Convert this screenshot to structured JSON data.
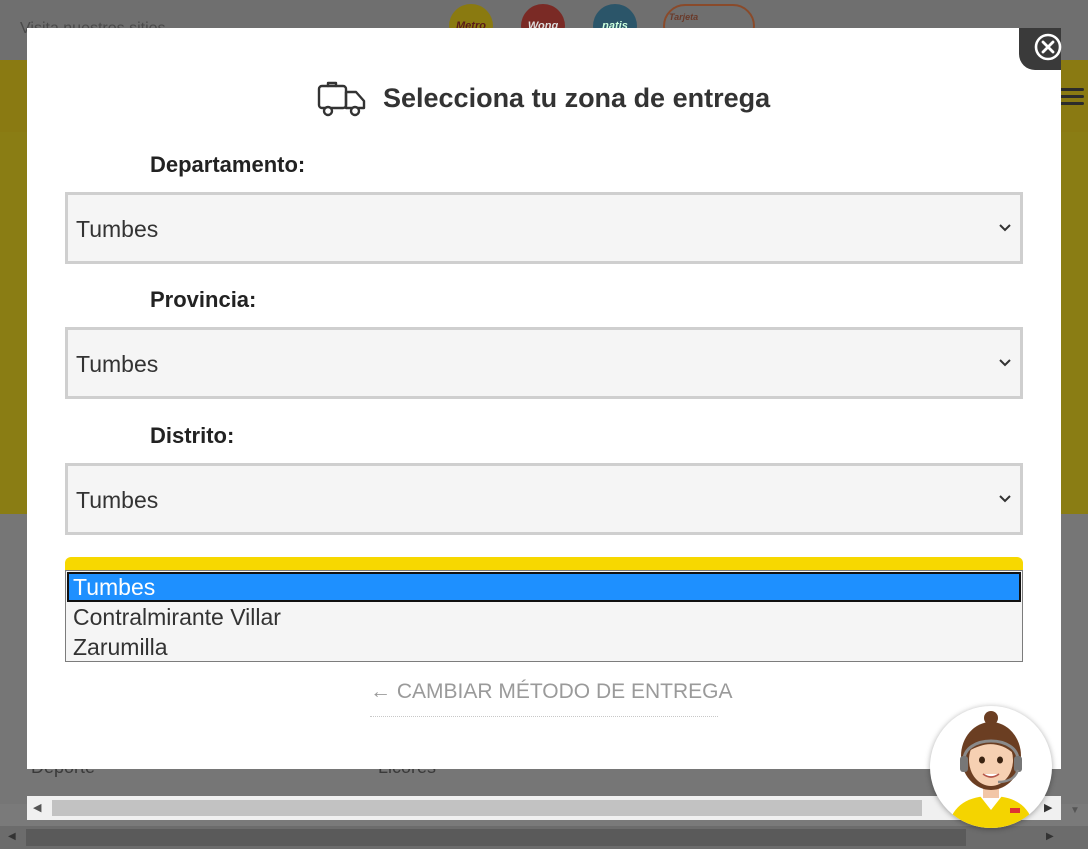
{
  "background": {
    "visit_text": "Visita nuestros sitios",
    "brand_logos": [
      {
        "label": "Metro",
        "color": "#d4b800"
      },
      {
        "label": "Wong",
        "color": "#c4332b"
      },
      {
        "label": "natis",
        "color": "#2d6f8f"
      },
      {
        "label": "Tarjeta",
        "color": "#d6582a"
      }
    ],
    "categories": [
      "Deporte",
      "Licores"
    ]
  },
  "modal": {
    "title": "Selecciona tu zona de entrega",
    "departamento": {
      "label": "Departamento:",
      "value": "Tumbes"
    },
    "provincia": {
      "label": "Provincia:",
      "value": "Tumbes"
    },
    "distrito": {
      "label": "Distrito:",
      "value": "Tumbes",
      "options": [
        "Tumbes",
        "Contralmirante Villar",
        "Zarumilla"
      ],
      "highlighted": "Tumbes"
    },
    "change_method_link": "← CAMBIAR MÉTODO DE ENTREGA"
  },
  "colors": {
    "accent_yellow": "#f7d800",
    "selection_blue": "#1e90ff",
    "overlay_gray": "#7a7a7a"
  },
  "icons": {
    "truck": "truck-icon",
    "close": "close-icon",
    "chevron": "chevron-down-icon",
    "assistant": "chat-assistant-avatar"
  }
}
